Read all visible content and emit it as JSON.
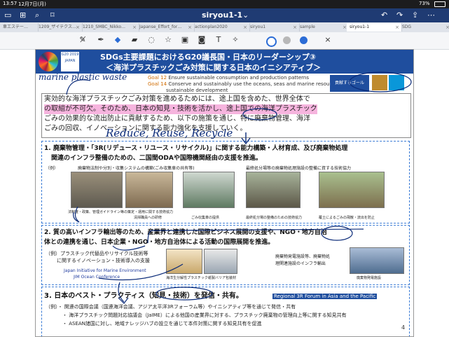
{
  "status": {
    "time": "13:57",
    "date": "12月7日(月)",
    "battery": "73%"
  },
  "window": {
    "title": "siryou1-1",
    "title_chevron": "⌄"
  },
  "tabs": [
    {
      "label": "車エステー…"
    },
    {
      "label": "1209_ザイテクス…"
    },
    {
      "label": "1210_SMBC_Nikko…"
    },
    {
      "label": "Japanse_Effort_for…"
    },
    {
      "label": "actionplan2020"
    },
    {
      "label": "siryou1"
    },
    {
      "label": "sample"
    },
    {
      "label": "siryou1-1"
    },
    {
      "label": "SDG"
    }
  ],
  "slide": {
    "title1": "SDGs主要課題におけるG20議長国・日本のリーダーシップ③",
    "title2": "＜海洋プラスチックごみ対策に関する日本のイニシアティブ＞",
    "g20_label": "G20 2019 JAPAN",
    "goals": [
      {
        "num": "Goal 12",
        "text": "Ensure sustainable consumption and production patterns"
      },
      {
        "num": "Goal 14",
        "text": "Conserve and sustainably use the oceans, seas and marine resources for"
      },
      {
        "num": "",
        "text": "sustainable development"
      }
    ],
    "goal_box": "貢献するゴール",
    "intro": [
      "実効的な海洋プラスチックごみ対策を進めるためには、途上国を含めた、世界全体で",
      "の取組が不可欠。そのため、日本の知見・技術を活かし、途上国での海洋プラスチック",
      "ごみの効果的な流出防止に貢献するため、以下の施策を通じ、特に廃棄物管理、海洋",
      "ごみの回収、イノベーションに関する能力強化を支援していく。"
    ],
    "sec1": {
      "title": "1. 廃棄物管理・「3R(リデュース・リユース・リサイクル)」に関する能力構築・人材育成、及び廃棄物処理",
      "title2": "関連のインフラ整備のための、二国間ODAや国際機関経由の支援を推進。",
      "ex": "（例）",
      "cap_left": "廃棄物法制や分別・収集システムの構築(ごみ収集車の共有等)",
      "cap_right": "最終処分場等の廃棄物処理施設の整備に資する技術協力",
      "photos": [
        "法制度・政策、管理ガイドライン等の策定・運用に関する技術協力",
        "清掃職員への研修",
        "ごみ収集車の提供",
        "最終処分場の整備のための技術協力",
        "覆土によるごみの飛散・流出を防止"
      ]
    },
    "sec2": {
      "title": "2. 質の高いインフラ輸出等のため、産業界と連携した国際ビジネス展開の支援や、NGO・地方自治",
      "title2": "体との連携を通じ、日本企業・NGO・地方自治体による活動の国際展開を推進。",
      "ex": "（例）プラスチック代替品やリサイクル技術等",
      "ex2": "に関するイノベーション・技術導入の支援",
      "jim": "Japan Initiative for Marine Environment",
      "jim2": "JIM Ocean Conference",
      "cap1": "海洋生分解性プラスチック",
      "cap2": "紙製バリア包装材",
      "cap3": "廃棄物発電施設等、廃棄物処",
      "cap4": "理関連施設のインフラ輸出",
      "cap5": "廃棄物発電施設"
    },
    "sec3": {
      "title": "3. 日本のベスト・プラクティス（知見・技術）を発信・共有。",
      "regional": "Regional 3R Forum in Asia and the Pacific",
      "items": [
        "（例）・ 関連の国際会議（国連海洋会議、アジア太平洋3Rフォーラム等）やイニシアティブ等を通じて発信・共有",
        "・ 海洋プラスチック問題対応協議会（JaIME）による他国の産業界に対する、プラスチック廃棄物の管理向上等に関する知見共有",
        "・ ASEAN諸国に対し、地域ナレッジハブの設立を通じて本件対策に関する知見共有を促進"
      ]
    },
    "page": "4",
    "notes": {
      "marine": "marine plastic waste",
      "reduce": "Reduce, Reuse, Recycle"
    }
  }
}
